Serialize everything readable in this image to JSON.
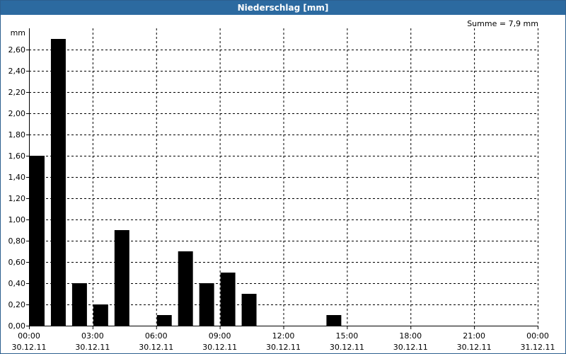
{
  "window": {
    "title": "Niederschlag [mm]"
  },
  "summary": "Summe = 7,9 mm",
  "chart_data": {
    "type": "bar",
    "title": "Niederschlag [mm]",
    "ylabel": "mm",
    "xlabel": "",
    "ylim": [
      0,
      2.8
    ],
    "yticks": [
      0,
      0.2,
      0.4,
      0.6,
      0.8,
      1.0,
      1.2,
      1.4,
      1.6,
      1.8,
      2.0,
      2.2,
      2.4,
      2.6
    ],
    "ytick_labels": [
      "0,00",
      "0,20",
      "0,40",
      "0,60",
      "0,80",
      "1,00",
      "1,20",
      "1,40",
      "1,60",
      "1,80",
      "2,00",
      "2,20",
      "2,40",
      "2,60"
    ],
    "xlim_hours": [
      0,
      24
    ],
    "xticks": [
      {
        "time": "00:00",
        "date": "30.12.11"
      },
      {
        "time": "03:00",
        "date": "30.12.11"
      },
      {
        "time": "06:00",
        "date": "30.12.11"
      },
      {
        "time": "09:00",
        "date": "30.12.11"
      },
      {
        "time": "12:00",
        "date": "30.12.11"
      },
      {
        "time": "15:00",
        "date": "30.12.11"
      },
      {
        "time": "18:00",
        "date": "30.12.11"
      },
      {
        "time": "21:00",
        "date": "30.12.11"
      },
      {
        "time": "00:00",
        "date": "31.12.11"
      }
    ],
    "bar_start_hours": [
      0,
      1,
      2,
      3,
      4,
      5,
      6,
      7,
      8,
      9,
      10,
      11,
      12,
      13,
      14
    ],
    "values": [
      1.6,
      2.7,
      0.4,
      0.2,
      0.9,
      0.0,
      0.1,
      0.7,
      0.4,
      0.5,
      0.3,
      0.0,
      0.0,
      0.0,
      0.1
    ],
    "grid": true,
    "bar_color": "#000000",
    "grid_color": "#000000"
  }
}
